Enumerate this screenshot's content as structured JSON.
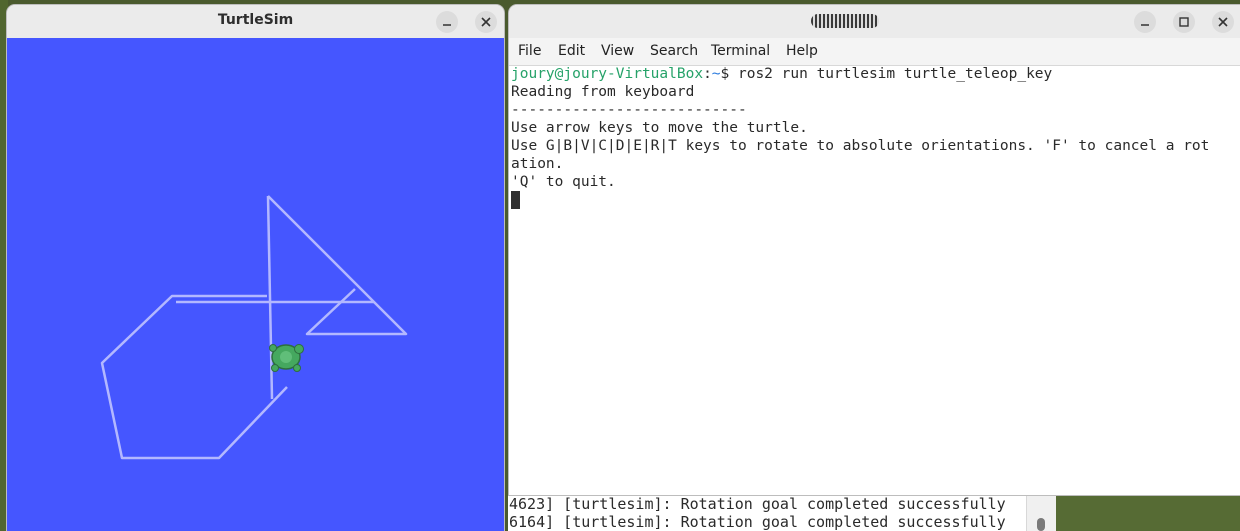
{
  "turtlesim_window": {
    "title": "TurtleSim",
    "canvas_color": "#4556ff",
    "pen_color": "#b3b8ff",
    "turtle_color": "#45a85f",
    "minimize_icon": "minimize-icon",
    "close_icon": "close-icon"
  },
  "terminal_window": {
    "menu": [
      "File",
      "Edit",
      "View",
      "Search",
      "Terminal",
      "Help"
    ],
    "prompt": {
      "user_host": "joury@joury-VirtualBox",
      "separator": ":",
      "path": "~",
      "symbol": "$",
      "command": " ros2 run turtlesim turtle_teleop_key"
    },
    "output": [
      "Reading from keyboard",
      "---------------------------",
      "Use arrow keys to move the turtle.",
      "Use G|B|V|C|D|E|R|T keys to rotate to absolute orientations. 'F' to cancel a rot",
      "ation.",
      "'Q' to quit."
    ],
    "window_buttons": [
      "minimize-icon",
      "maximize-icon",
      "close-icon"
    ]
  },
  "background_terminal": {
    "lines": [
      "4623] [turtlesim]: Rotation goal completed successfully",
      "6164] [turtlesim]: Rotation goal completed successfully"
    ]
  }
}
